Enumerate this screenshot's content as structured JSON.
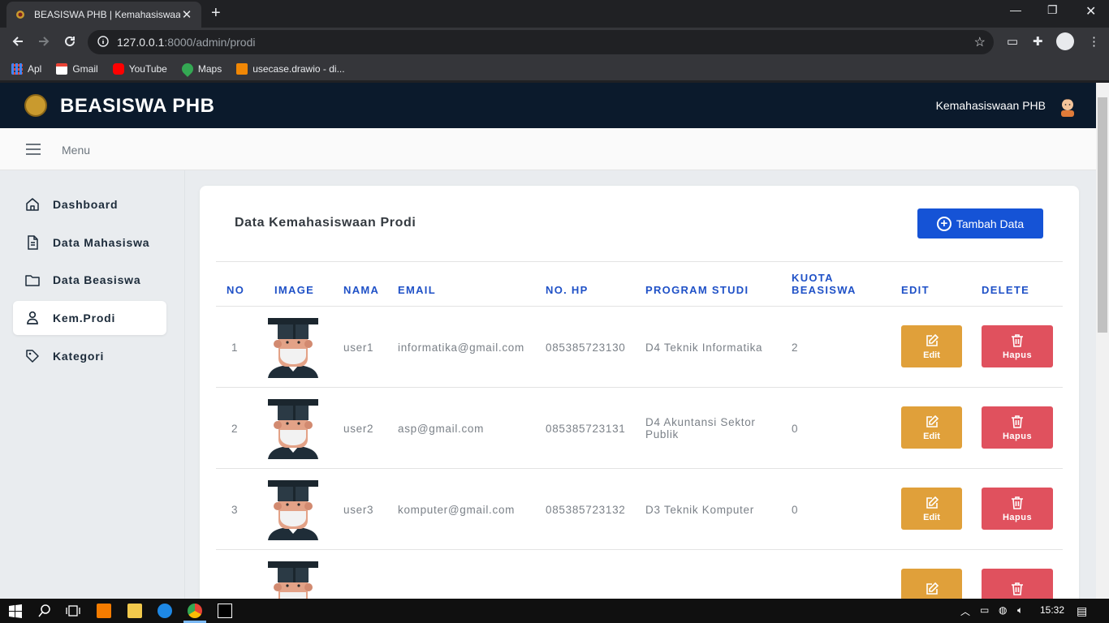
{
  "browser": {
    "tab_title": "BEASISWA PHB | Kemahasiswaan",
    "url_host": "127.0.0.1",
    "url_path": ":8000/admin/prodi",
    "bookmarks": [
      {
        "label": "Apl",
        "icon": "apps-grid-icon",
        "color": "#4285f4"
      },
      {
        "label": "Gmail",
        "icon": "gmail-icon",
        "color": "#ea4335"
      },
      {
        "label": "YouTube",
        "icon": "youtube-icon",
        "color": "#ff0000"
      },
      {
        "label": "Maps",
        "icon": "maps-icon",
        "color": "#34a853"
      },
      {
        "label": "usecase.drawio - di...",
        "icon": "drawio-icon",
        "color": "#f08705"
      }
    ]
  },
  "header": {
    "brand": "BEASISWA PHB",
    "user_name": "Kemahasiswaan PHB"
  },
  "menubar": {
    "label": "Menu"
  },
  "sidebar": {
    "items": [
      {
        "label": "Dashboard",
        "icon": "home-icon"
      },
      {
        "label": "Data Mahasiswa",
        "icon": "document-icon"
      },
      {
        "label": "Data Beasiswa",
        "icon": "folder-icon"
      },
      {
        "label": "Kem.Prodi",
        "icon": "user-icon",
        "active": true
      },
      {
        "label": "Kategori",
        "icon": "tag-icon"
      }
    ]
  },
  "main": {
    "title": "Data Kemahasiswaan Prodi",
    "add_button": "Tambah Data",
    "columns": [
      "NO",
      "IMAGE",
      "NAMA",
      "EMAIL",
      "NO. HP",
      "PROGRAM STUDI",
      "KUOTA BEASISWA",
      "EDIT",
      "DELETE"
    ],
    "rows": [
      {
        "no": "1",
        "nama": "user1",
        "email": "informatika@gmail.com",
        "hp": "085385723130",
        "prodi": "D4 Teknik Informatika",
        "kuota": "2",
        "edit": "Edit",
        "delete": "Hapus"
      },
      {
        "no": "2",
        "nama": "user2",
        "email": "asp@gmail.com",
        "hp": "085385723131",
        "prodi": "D4 Akuntansi Sektor Publik",
        "kuota": "0",
        "edit": "Edit",
        "delete": "Hapus"
      },
      {
        "no": "3",
        "nama": "user3",
        "email": "komputer@gmail.com",
        "hp": "085385723132",
        "prodi": "D3 Teknik Komputer",
        "kuota": "0",
        "edit": "Edit",
        "delete": "Hapus"
      },
      {
        "no": "",
        "nama": "",
        "email": "",
        "hp": "",
        "prodi": "",
        "kuota": "",
        "edit": "",
        "delete": ""
      }
    ]
  },
  "taskbar": {
    "time": "15:32"
  },
  "colors": {
    "primary": "#1553d6",
    "edit": "#e0a03a",
    "delete": "#e0515e",
    "nav": "#0b1a2c"
  }
}
